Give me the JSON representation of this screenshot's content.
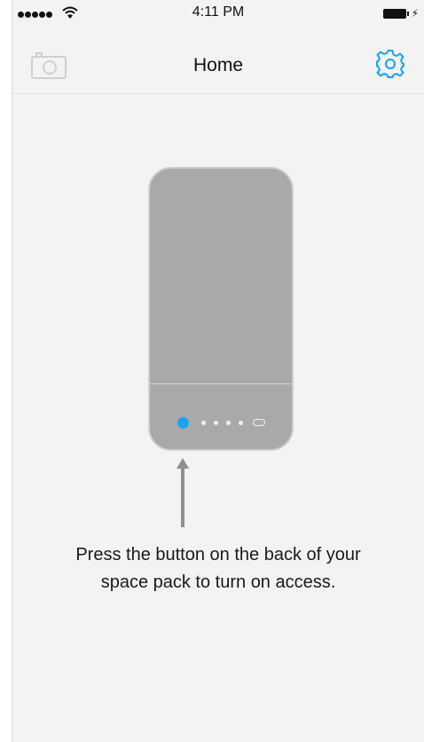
{
  "status_bar": {
    "time": "4:11 PM",
    "signal_icon": "signal-dots-icon",
    "wifi_icon": "wifi-icon",
    "battery_icon": "battery-charging-icon"
  },
  "nav": {
    "title": "Home",
    "left_icon": "camera-icon",
    "right_icon": "gear-icon"
  },
  "instruction": "Press the button on the back of your space pack to turn on access.",
  "colors": {
    "accent": "#1aa3f2",
    "device_body": "#a9a9ab",
    "background": "#f3f3f3"
  }
}
